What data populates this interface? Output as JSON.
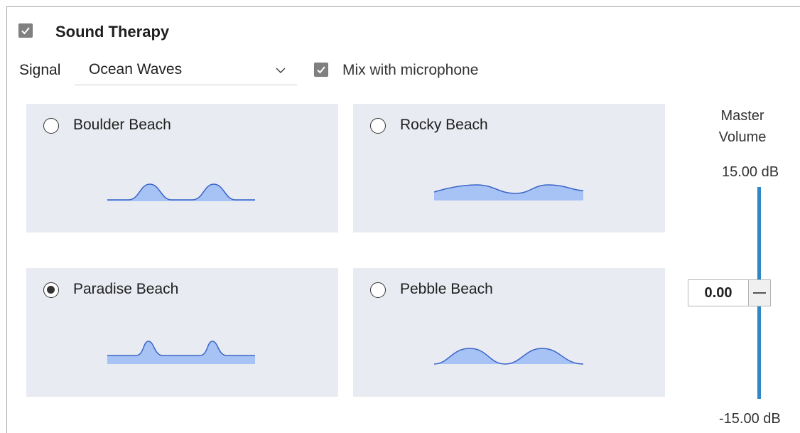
{
  "panel": {
    "title": "Sound Therapy",
    "enabled": true
  },
  "signal": {
    "label": "Signal",
    "selected": "Ocean Waves"
  },
  "mix": {
    "label": "Mix with microphone",
    "checked": true
  },
  "presets": [
    {
      "label": "Boulder Beach",
      "selected": false,
      "waveform": "peaked-humps"
    },
    {
      "label": "Rocky Beach",
      "selected": false,
      "waveform": "gentle-swells"
    },
    {
      "label": "Paradise Beach",
      "selected": true,
      "waveform": "peaked-humps"
    },
    {
      "label": "Pebble Beach",
      "selected": false,
      "waveform": "rounded-humps"
    }
  ],
  "volume": {
    "heading_line1": "Master",
    "heading_line2": "Volume",
    "max_label": "15.00 dB",
    "min_label": "-15.00 dB",
    "value": "0.00",
    "value_db": 0.0,
    "range_db": [
      -15.0,
      15.0
    ]
  },
  "colors": {
    "card_bg": "#e9ebf2",
    "wave_fill": "#a7c3f5",
    "wave_stroke": "#3a64c8",
    "slider_track": "#2f87c6",
    "checkbox_bg": "#808080"
  }
}
